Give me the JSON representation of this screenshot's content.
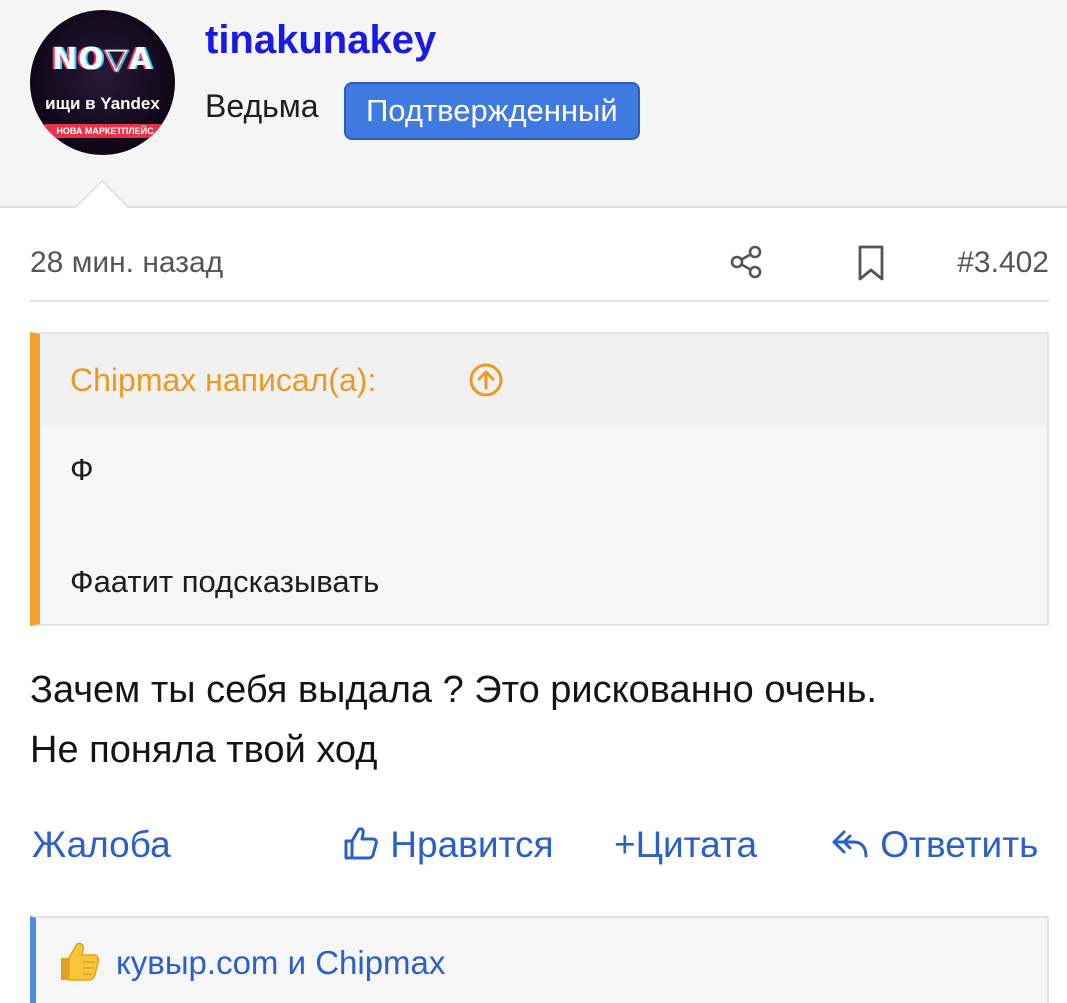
{
  "user": {
    "avatar": {
      "logo_text": "NO▽A",
      "tagline": "ищи в Yandex",
      "strip_text": "НОВА МАРКЕТПЛЕЙС"
    },
    "username": "tinakunakey",
    "title": "Ведьма",
    "badge": "Подтвержденный"
  },
  "post": {
    "time": "28 мин. назад",
    "number": "#3.402",
    "icons": {
      "share": "share-icon",
      "bookmark": "bookmark-icon"
    }
  },
  "quote": {
    "author": "Chipmax написал(а):",
    "lines": [
      "Ф",
      "Фаатит подсказывать"
    ],
    "accent_color": "#f0a22a"
  },
  "message": {
    "line1": "Зачем ты себя выдала ? Это рискованно очень.",
    "line2": "Не поняла твой ход"
  },
  "actions": {
    "report": "Жалоба",
    "like": "Нравится",
    "quote": "Цитата",
    "reply": "Ответить",
    "link_color": "#2a60c8"
  },
  "reactions": {
    "text": "кувыр.com и Chipmax",
    "icon": "thumbs-up-emoji"
  }
}
